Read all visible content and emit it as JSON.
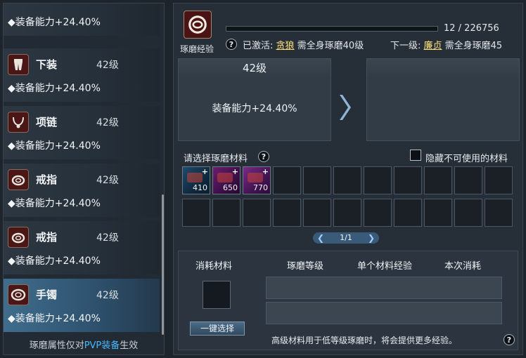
{
  "left_list": {
    "items": [
      {
        "name": "",
        "level": "",
        "attr": "◆装备能力+24.40%",
        "icon": "armor-icon"
      },
      {
        "name": "下装",
        "level": "42级",
        "attr": "◆装备能力+24.40%",
        "icon": "pants-icon"
      },
      {
        "name": "项链",
        "level": "42级",
        "attr": "◆装备能力+24.40%",
        "icon": "necklace-icon"
      },
      {
        "name": "戒指",
        "level": "42级",
        "attr": "◆装备能力+24.40%",
        "icon": "ring-icon"
      },
      {
        "name": "戒指",
        "level": "42级",
        "attr": "◆装备能力+24.40%",
        "icon": "ring-icon"
      },
      {
        "name": "手镯",
        "level": "42级",
        "attr": "◆装备能力+24.40%",
        "icon": "bracelet-icon"
      }
    ],
    "footer_prefix": "琢磨属性仅对",
    "footer_highlight": "PVP装备",
    "footer_suffix": "生效"
  },
  "top": {
    "label": "琢磨经验",
    "exp_text": "12 / 226756",
    "exp_fraction": 5e-05,
    "help": "?",
    "activated_prefix": "已激活: ",
    "activated_name": "贪狼",
    "activated_suffix": " 需全身琢磨40级",
    "next_prefix": "下一级: ",
    "next_name": "廉贞",
    "next_suffix": " 需全身琢磨45"
  },
  "current_card": {
    "title": "42级",
    "attr": "装备能力+24.40%"
  },
  "next_card": {
    "title": "",
    "attr": ""
  },
  "materials": {
    "title": "请选择琢磨材料",
    "help": "?",
    "hide_label": "隐藏不可使用的材料",
    "items": [
      {
        "count": "410",
        "variant": "c1"
      },
      {
        "count": "650",
        "variant": "c2"
      },
      {
        "count": "770",
        "variant": "c3"
      }
    ],
    "page": "1/1",
    "page_prev": "❮",
    "page_next": "❯"
  },
  "cost": {
    "headers": [
      "消耗材料",
      "琢磨等级",
      "单个材料经验",
      "本次消耗"
    ],
    "one_key": "一键选择",
    "note": "高级材料用于低等级琢磨时，将会提供更多经验。",
    "help": "?"
  },
  "colors": {
    "highlight": "#ffe17a",
    "pvp": "#49b7ff",
    "selected_row": "#3f6d8c"
  }
}
